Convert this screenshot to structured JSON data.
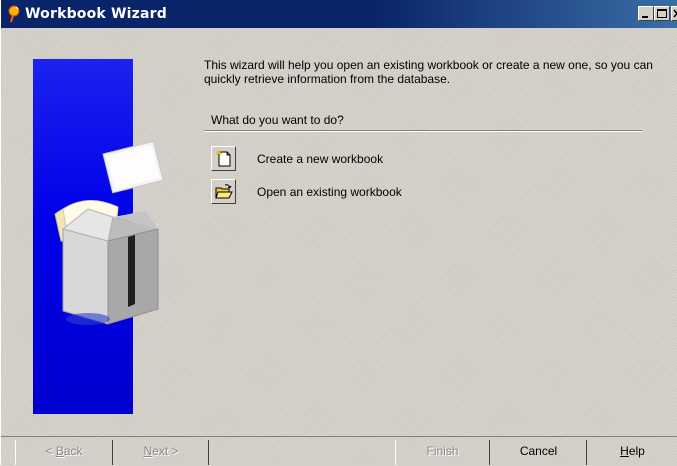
{
  "window": {
    "title": "Workbook Wizard",
    "title_icon": "bulb-icon",
    "controls": [
      "minimize-icon",
      "maximize-icon",
      "close-icon"
    ]
  },
  "content": {
    "intro": "This wizard will help you open an existing workbook or create a new one, so you can quickly retrieve information from the database.",
    "question": "What do you want to do?",
    "options": [
      {
        "label": "Create a new workbook",
        "icon": "new-workbook-icon"
      },
      {
        "label": "Open an existing workbook",
        "icon": "open-folder-icon"
      }
    ]
  },
  "buttons": {
    "back": {
      "label": "< Back",
      "mnemonic": "B",
      "enabled": false
    },
    "next": {
      "label": "Next >",
      "mnemonic": "N",
      "enabled": false
    },
    "finish": {
      "label": "Finish",
      "enabled": false
    },
    "cancel": {
      "label": "Cancel",
      "enabled": true
    },
    "help": {
      "label": "Help",
      "mnemonic": "H",
      "enabled": true
    }
  },
  "colors": {
    "titlebar": "#0a246a",
    "side_panel": "#0000e8",
    "face": "#d4d0c8"
  }
}
